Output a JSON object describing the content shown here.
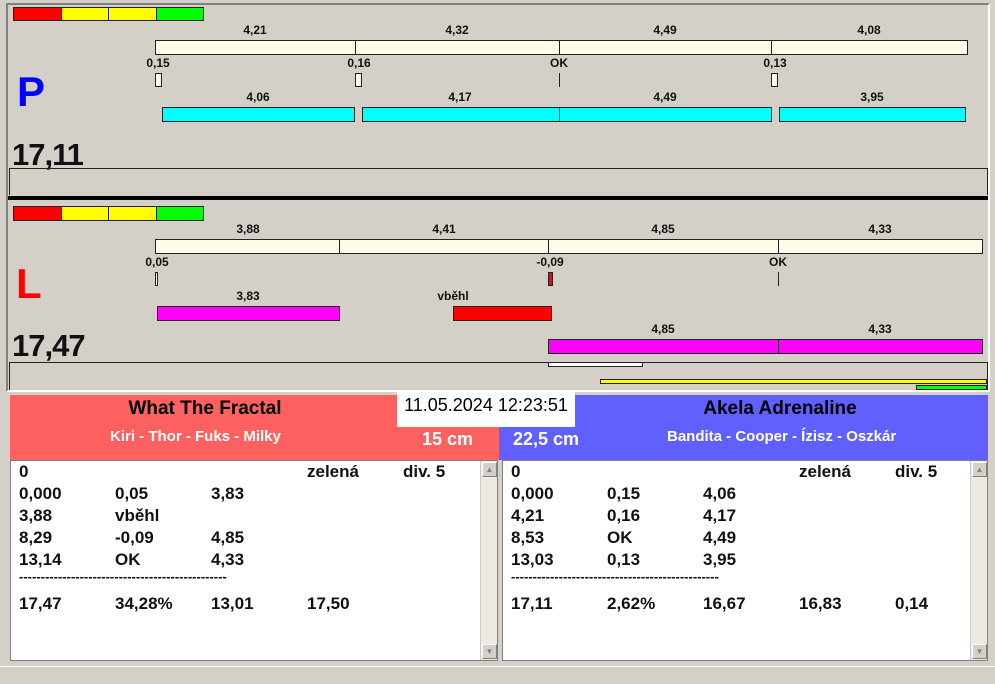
{
  "colors": {
    "red_team": "#ff6060",
    "blue_team": "#6060ff"
  },
  "p": {
    "side": "P",
    "total": "17,11",
    "top_labels": [
      "4,21",
      "4,32",
      "4,49",
      "4,08"
    ],
    "mid_labels": [
      "0,15",
      "0,16",
      "OK",
      "0,13"
    ],
    "bottom_labels": [
      "4,06",
      "4,17",
      "4,49",
      "3,95"
    ]
  },
  "l": {
    "side": "L",
    "total": "17,47",
    "top_labels": [
      "3,88",
      "4,41",
      "4,85",
      "4,33"
    ],
    "mid_labels": [
      "0,05",
      "-0,09",
      "OK"
    ],
    "row1_labels": [
      "3,83",
      "vběhl"
    ],
    "row2_labels": [
      "4,85",
      "4,33"
    ]
  },
  "timestamp": "11.05.2024 12:23:51",
  "left_team": {
    "name": "What The Fractal",
    "dogs": "Kiri - Thor - Fuks - Milky",
    "height": "15 cm",
    "rows": [
      [
        "0",
        "",
        "",
        "zelená",
        "div. 5"
      ],
      [
        "0,000",
        "0,05",
        "3,83",
        "",
        ""
      ],
      [
        "3,88",
        "vběhl",
        "",
        "",
        ""
      ],
      [
        "8,29",
        "-0,09",
        "4,85",
        "",
        ""
      ],
      [
        "13,14",
        "OK",
        "4,33",
        "",
        ""
      ]
    ],
    "separator": "------------------------------------------------",
    "summary": [
      "17,47",
      "34,28%",
      "13,01",
      "17,50",
      ""
    ]
  },
  "right_team": {
    "name": "Akela  Adrenaline",
    "dogs": "Bandita - Cooper - Ízisz - Oszkár",
    "height": "22,5 cm",
    "rows": [
      [
        "0",
        "",
        "",
        "zelená",
        "div. 5"
      ],
      [
        "0,000",
        "0,15",
        "4,06",
        "",
        ""
      ],
      [
        "4,21",
        "0,16",
        "4,17",
        "",
        ""
      ],
      [
        "8,53",
        "OK",
        "4,49",
        "",
        ""
      ],
      [
        "13,03",
        "0,13",
        "3,95",
        "",
        ""
      ]
    ],
    "separator": "------------------------------------------------",
    "summary": [
      "17,11",
      "2,62%",
      "16,67",
      "16,83",
      "0,14"
    ]
  }
}
